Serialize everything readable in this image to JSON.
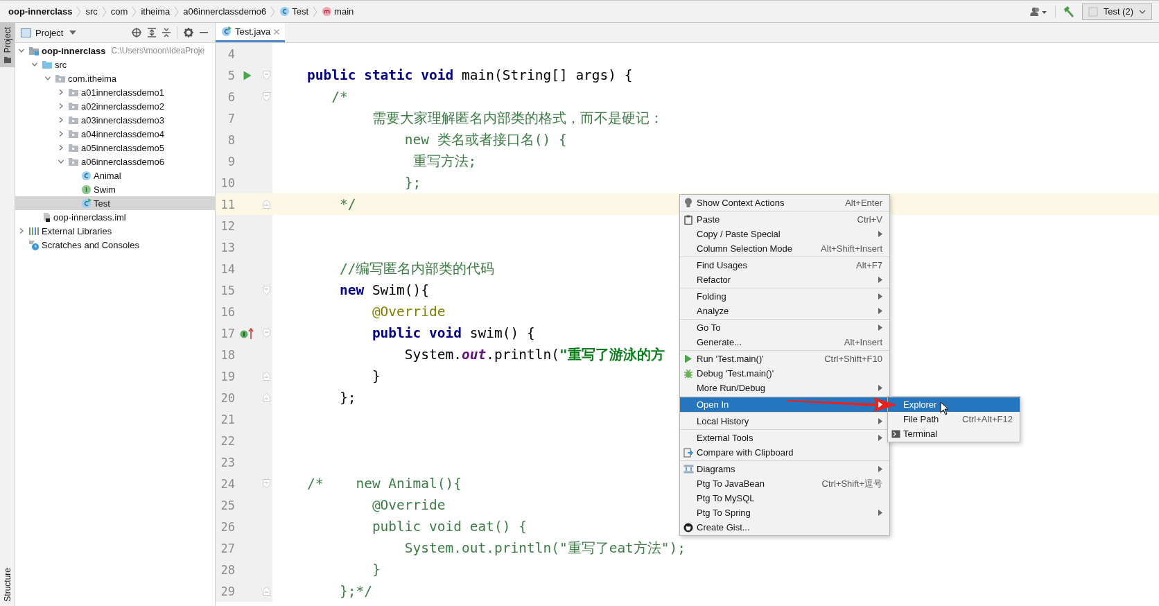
{
  "breadcrumbs": [
    {
      "label": "oop-innerclass",
      "kind": "module"
    },
    {
      "label": "src",
      "kind": "folder"
    },
    {
      "label": "com",
      "kind": "folder"
    },
    {
      "label": "itheima",
      "kind": "folder"
    },
    {
      "label": "a06innerclassdemo6",
      "kind": "folder"
    },
    {
      "label": "Test",
      "kind": "class"
    },
    {
      "label": "main",
      "kind": "method"
    }
  ],
  "toolbar": {
    "run_config": "Test (2)"
  },
  "side_tabs_top": [
    {
      "label": "Project",
      "selected": true
    }
  ],
  "side_tabs_bottom": [
    {
      "label": "Structure",
      "selected": false
    }
  ],
  "project_panel": {
    "title": "Project",
    "tree": [
      {
        "label": "oop-innerclass",
        "kind": "module",
        "path": "C:\\Users\\moon\\IdeaProje",
        "expanded": true,
        "selected": false,
        "children": [
          {
            "label": "src",
            "kind": "source",
            "expanded": true,
            "selected": false,
            "children": [
              {
                "label": "com.itheima",
                "kind": "package",
                "expanded": true,
                "selected": false,
                "children": [
                  {
                    "label": "a01innerclassdemo1",
                    "kind": "package",
                    "expanded": false,
                    "selected": false
                  },
                  {
                    "label": "a02innerclassdemo2",
                    "kind": "package",
                    "expanded": false,
                    "selected": false
                  },
                  {
                    "label": "a03innerclassdemo3",
                    "kind": "package",
                    "expanded": false,
                    "selected": false
                  },
                  {
                    "label": "a04innerclassdemo4",
                    "kind": "package",
                    "expanded": false,
                    "selected": false
                  },
                  {
                    "label": "a05innerclassdemo5",
                    "kind": "package",
                    "expanded": false,
                    "selected": false
                  },
                  {
                    "label": "a06innerclassdemo6",
                    "kind": "package",
                    "expanded": true,
                    "selected": false,
                    "children": [
                      {
                        "label": "Animal",
                        "kind": "class",
                        "selected": false
                      },
                      {
                        "label": "Swim",
                        "kind": "interface",
                        "selected": false
                      },
                      {
                        "label": "Test",
                        "kind": "runnable",
                        "selected": true
                      }
                    ]
                  }
                ]
              }
            ]
          },
          {
            "label": "oop-innerclass.iml",
            "kind": "file",
            "selected": false
          }
        ]
      },
      {
        "label": "External Libraries",
        "kind": "libraries",
        "expanded": false,
        "selected": false
      },
      {
        "label": "Scratches and Consoles",
        "kind": "scratches",
        "selected": false
      }
    ]
  },
  "editor_tabs": [
    {
      "label": "Test.java",
      "selected": true
    }
  ],
  "editor": {
    "lines": [
      {
        "number": "4",
        "current": false
      },
      {
        "number": "5",
        "current": false,
        "marker": {
          "kind": "run"
        },
        "fold": {
          "kind": "start"
        },
        "tokens": [
          {
            "text": "    public static void",
            "kind": "keyword"
          },
          {
            "text": " main(String[] args) {",
            "kind": "plain"
          }
        ]
      },
      {
        "number": "6",
        "current": false,
        "fold": {
          "kind": "start"
        },
        "tokens": [
          {
            "text": "       /*",
            "kind": "comment"
          }
        ]
      },
      {
        "number": "7",
        "current": false,
        "tokens": [
          {
            "text": "            需要大家理解匿名内部类的格式，而不是硬记：",
            "kind": "comment"
          }
        ]
      },
      {
        "number": "8",
        "current": false,
        "tokens": [
          {
            "text": "                new 类名或者接口名() {",
            "kind": "comment"
          }
        ]
      },
      {
        "number": "9",
        "current": false,
        "tokens": [
          {
            "text": "                 重写方法;",
            "kind": "comment"
          }
        ]
      },
      {
        "number": "10",
        "current": false,
        "tokens": [
          {
            "text": "                };",
            "kind": "comment"
          }
        ]
      },
      {
        "number": "11",
        "current": true,
        "fold": {
          "kind": "end"
        },
        "tokens": [
          {
            "text": "        */",
            "kind": "comment"
          }
        ]
      },
      {
        "number": "12",
        "current": false
      },
      {
        "number": "13",
        "current": false
      },
      {
        "number": "14",
        "current": false,
        "tokens": [
          {
            "text": "        //编写匿名内部类的代码",
            "kind": "comment"
          }
        ]
      },
      {
        "number": "15",
        "current": false,
        "fold": {
          "kind": "start"
        },
        "tokens": [
          {
            "text": "        new",
            "kind": "keyword"
          },
          {
            "text": " Swim(){",
            "kind": "plain"
          }
        ]
      },
      {
        "number": "16",
        "current": false,
        "tokens": [
          {
            "text": "            @Override",
            "kind": "annotation"
          }
        ]
      },
      {
        "number": "17",
        "current": false,
        "marker": {
          "kind": "implements"
        },
        "fold": {
          "kind": "start"
        },
        "tokens": [
          {
            "text": "            public void",
            "kind": "keyword"
          },
          {
            "text": " swim() {",
            "kind": "plain"
          }
        ]
      },
      {
        "number": "18",
        "current": false,
        "tokens": [
          {
            "text": "                System.",
            "kind": "plain"
          },
          {
            "text": "out",
            "kind": "field"
          },
          {
            "text": ".println(",
            "kind": "plain"
          },
          {
            "text": "\"重写了游泳的方",
            "kind": "string"
          }
        ]
      },
      {
        "number": "19",
        "current": false,
        "fold": {
          "kind": "end"
        },
        "tokens": [
          {
            "text": "            }",
            "kind": "plain"
          }
        ]
      },
      {
        "number": "20",
        "current": false,
        "fold": {
          "kind": "end"
        },
        "tokens": [
          {
            "text": "        };",
            "kind": "plain"
          }
        ]
      },
      {
        "number": "21",
        "current": false
      },
      {
        "number": "22",
        "current": false
      },
      {
        "number": "23",
        "current": false
      },
      {
        "number": "24",
        "current": false,
        "fold": {
          "kind": "start"
        },
        "tokens": [
          {
            "text": "    /*    new Animal(){",
            "kind": "comment"
          }
        ]
      },
      {
        "number": "25",
        "current": false,
        "tokens": [
          {
            "text": "            @Override",
            "kind": "comment"
          }
        ]
      },
      {
        "number": "26",
        "current": false,
        "tokens": [
          {
            "text": "            public void eat() {",
            "kind": "comment"
          }
        ]
      },
      {
        "number": "27",
        "current": false,
        "tokens": [
          {
            "text": "                System.out.println(\"重写了eat方法\");",
            "kind": "comment"
          }
        ]
      },
      {
        "number": "28",
        "current": false,
        "tokens": [
          {
            "text": "            }",
            "kind": "comment"
          }
        ]
      },
      {
        "number": "29",
        "current": false,
        "fold": {
          "kind": "end"
        },
        "tokens": [
          {
            "text": "        };*/",
            "kind": "comment"
          }
        ]
      }
    ]
  },
  "context_menu": {
    "sections": [
      [
        {
          "label": "Show Context Actions",
          "shortcut": "Alt+Enter",
          "kind": "bulb",
          "submenu": false,
          "selected": false
        }
      ],
      [
        {
          "label": "Paste",
          "shortcut": "Ctrl+V",
          "kind": "clipboard",
          "submenu": false,
          "selected": false
        },
        {
          "label": "Copy / Paste Special",
          "kind": "plain",
          "submenu": true,
          "selected": false
        },
        {
          "label": "Column Selection Mode",
          "shortcut": "Alt+Shift+Insert",
          "kind": "plain",
          "submenu": false,
          "selected": false
        }
      ],
      [
        {
          "label": "Find Usages",
          "shortcut": "Alt+F7",
          "kind": "plain",
          "submenu": false,
          "selected": false
        },
        {
          "label": "Refactor",
          "kind": "plain",
          "submenu": true,
          "selected": false
        }
      ],
      [
        {
          "label": "Folding",
          "kind": "plain",
          "submenu": true,
          "selected": false
        },
        {
          "label": "Analyze",
          "kind": "plain",
          "submenu": true,
          "selected": false
        }
      ],
      [
        {
          "label": "Go To",
          "kind": "plain",
          "submenu": true,
          "selected": false
        },
        {
          "label": "Generate...",
          "shortcut": "Alt+Insert",
          "kind": "plain",
          "submenu": false,
          "selected": false
        }
      ],
      [
        {
          "label": "Run 'Test.main()'",
          "shortcut": "Ctrl+Shift+F10",
          "kind": "run",
          "submenu": false,
          "selected": false
        },
        {
          "label": "Debug 'Test.main()'",
          "kind": "bug",
          "submenu": false,
          "selected": false
        },
        {
          "label": "More Run/Debug",
          "kind": "plain",
          "submenu": true,
          "selected": false
        }
      ],
      [
        {
          "label": "Open In",
          "kind": "plain",
          "submenu": true,
          "selected": true
        }
      ],
      [
        {
          "label": "Local History",
          "kind": "plain",
          "submenu": true,
          "selected": false
        }
      ],
      [
        {
          "label": "External Tools",
          "kind": "plain",
          "submenu": true,
          "selected": false
        },
        {
          "label": "Compare with Clipboard",
          "kind": "compare",
          "submenu": false,
          "selected": false
        }
      ],
      [
        {
          "label": "Diagrams",
          "kind": "diagram",
          "submenu": true,
          "selected": false
        },
        {
          "label": "Ptg To JavaBean",
          "shortcut": "Ctrl+Shift+逗号",
          "kind": "plain",
          "submenu": false,
          "selected": false
        },
        {
          "label": "Ptg To MySQL",
          "kind": "plain",
          "submenu": false,
          "selected": false
        },
        {
          "label": "Ptg To Spring",
          "kind": "plain",
          "submenu": true,
          "selected": false
        },
        {
          "label": "Create Gist...",
          "kind": "github",
          "submenu": false,
          "selected": false
        }
      ]
    ]
  },
  "submenu": {
    "items": [
      {
        "label": "Explorer",
        "kind": "plain",
        "selected": true
      },
      {
        "label": "File Path",
        "shortcut": "Ctrl+Alt+F12",
        "kind": "plain",
        "selected": false
      },
      {
        "label": "Terminal",
        "kind": "terminal",
        "selected": false
      }
    ]
  }
}
